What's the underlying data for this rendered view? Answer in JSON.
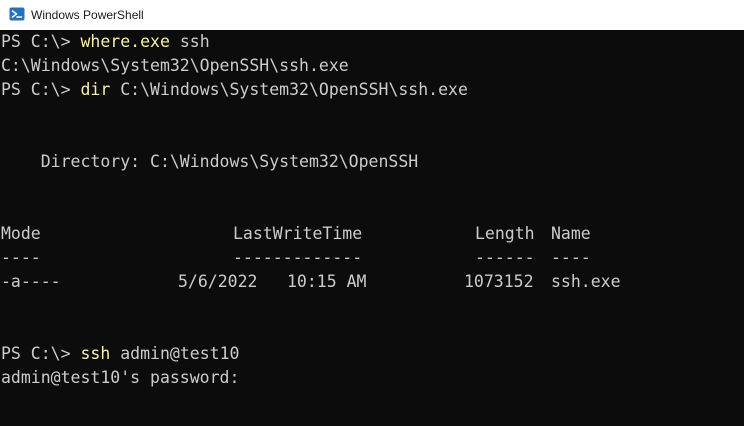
{
  "window": {
    "title": "Windows PowerShell"
  },
  "terminal": {
    "l1": {
      "prompt": "PS C:\\> ",
      "command": "where.exe",
      "args": " ssh"
    },
    "l2": {
      "text": "C:\\Windows\\System32\\OpenSSH\\ssh.exe"
    },
    "l3": {
      "prompt": "PS C:\\> ",
      "command": "dir",
      "args": " C:\\Windows\\System32\\OpenSSH\\ssh.exe"
    },
    "l4": {
      "text": "    Directory: C:\\Windows\\System32\\OpenSSH"
    },
    "headers": {
      "mode": "Mode",
      "lastwrite": "LastWriteTime",
      "length": "Length",
      "name": "Name"
    },
    "underline": {
      "mode": "----",
      "lastwrite": "-------------",
      "length": "------",
      "name": "----"
    },
    "row": {
      "mode": "-a----",
      "date": "5/6/2022",
      "time": "10:15 AM",
      "length": "1073152",
      "name": "ssh.exe"
    },
    "l5": {
      "prompt": "PS C:\\> ",
      "command": "ssh",
      "args": " admin@test10"
    },
    "l6": {
      "text": "admin@test10's password:"
    }
  },
  "colors": {
    "background": "#0c0c0c",
    "text": "#cccccc",
    "command": "#f9f1a5",
    "titlebar": "#ffffff"
  },
  "icons": {
    "app": "powershell-icon"
  }
}
